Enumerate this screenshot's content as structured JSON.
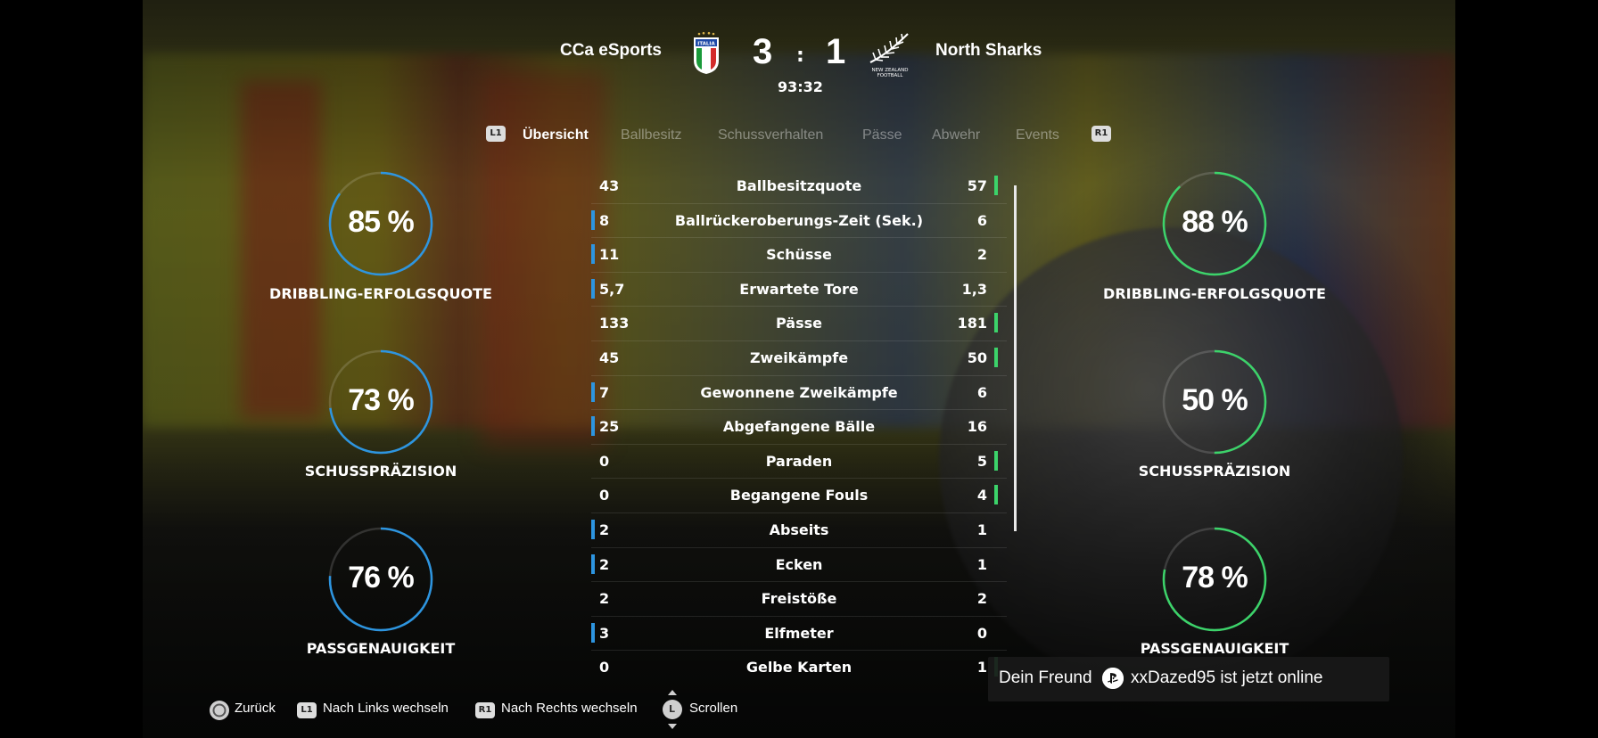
{
  "match": {
    "home_team": "CCa eSports",
    "away_team": "North Sharks",
    "home_score": "3",
    "away_score": "1",
    "separator": ":",
    "clock": "93:32",
    "home_crest_text": "ITALIA",
    "away_crest_text": "NEW ZEALAND FOOTBALL"
  },
  "tabs": {
    "left_key": "L1",
    "right_key": "R1",
    "items": [
      "Übersicht",
      "Ballbesitz",
      "Schussverhalten",
      "Pässe",
      "Abwehr",
      "Events"
    ],
    "active": "Übersicht"
  },
  "gauges": {
    "home": [
      {
        "value": "85 %",
        "label": "DRIBBLING-ERFOLGSQUOTE",
        "fraction": 0.85
      },
      {
        "value": "73 %",
        "label": "SCHUSSPRÄZISION",
        "fraction": 0.73
      },
      {
        "value": "76 %",
        "label": "PASSGENAUIGKEIT",
        "fraction": 0.76
      }
    ],
    "away": [
      {
        "value": "88 %",
        "label": "DRIBBLING-ERFOLGSQUOTE",
        "fraction": 0.88
      },
      {
        "value": "50 %",
        "label": "SCHUSSPRÄZISION",
        "fraction": 0.5
      },
      {
        "value": "78 %",
        "label": "PASSGENAUIGKEIT",
        "fraction": 0.78
      }
    ]
  },
  "stats": [
    {
      "home": "43",
      "name": "Ballbesitzquote",
      "away": "57",
      "leader": "away"
    },
    {
      "home": "8",
      "name": "Ballrückeroberungs-Zeit (Sek.)",
      "away": "6",
      "leader": "home"
    },
    {
      "home": "11",
      "name": "Schüsse",
      "away": "2",
      "leader": "home"
    },
    {
      "home": "5,7",
      "name": "Erwartete Tore",
      "away": "1,3",
      "leader": "home"
    },
    {
      "home": "133",
      "name": "Pässe",
      "away": "181",
      "leader": "away"
    },
    {
      "home": "45",
      "name": "Zweikämpfe",
      "away": "50",
      "leader": "away"
    },
    {
      "home": "7",
      "name": "Gewonnene Zweikämpfe",
      "away": "6",
      "leader": "home"
    },
    {
      "home": "25",
      "name": "Abgefangene Bälle",
      "away": "16",
      "leader": "home"
    },
    {
      "home": "0",
      "name": "Paraden",
      "away": "5",
      "leader": "away"
    },
    {
      "home": "0",
      "name": "Begangene Fouls",
      "away": "4",
      "leader": "away"
    },
    {
      "home": "2",
      "name": "Abseits",
      "away": "1",
      "leader": "home"
    },
    {
      "home": "2",
      "name": "Ecken",
      "away": "1",
      "leader": "home"
    },
    {
      "home": "2",
      "name": "Freistöße",
      "away": "2",
      "leader": "none"
    },
    {
      "home": "3",
      "name": "Elfmeter",
      "away": "0",
      "leader": "home"
    },
    {
      "home": "0",
      "name": "Gelbe Karten",
      "away": "1",
      "leader": "away"
    }
  ],
  "colors": {
    "home_accent": "#2d95e0",
    "away_accent": "#3cd36a"
  },
  "footer": {
    "back": "Zurück",
    "left_key": "L1",
    "left": "Nach Links wechseln",
    "right_key": "R1",
    "right": "Nach Rechts wechseln",
    "scroll_key": "L",
    "scroll": "Scrollen"
  },
  "toast": {
    "prefix": "Dein Freund",
    "user": "xxDazed95 ist jetzt online"
  }
}
